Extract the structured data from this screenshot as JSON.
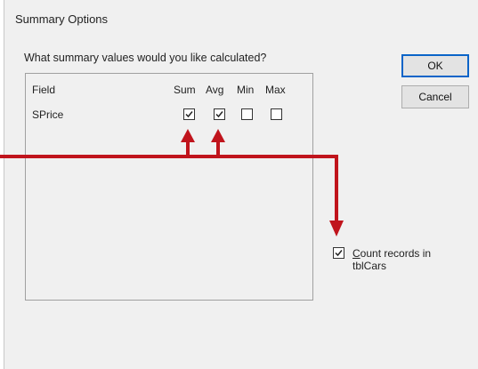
{
  "dialog": {
    "title": "Summary Options",
    "prompt": "What summary values would you like calculated?",
    "ok_label": "OK",
    "cancel_label": "Cancel"
  },
  "grid": {
    "headers": {
      "field": "Field",
      "sum": "Sum",
      "avg": "Avg",
      "min": "Min",
      "max": "Max"
    },
    "rows": [
      {
        "field": "SPrice",
        "sum": true,
        "avg": true,
        "min": false,
        "max": false
      }
    ]
  },
  "count_records": {
    "checked": true,
    "label_access_char": "C",
    "label_rest": "ount records in",
    "label_line2": "tblCars"
  },
  "colors": {
    "annotation": "#c0141c",
    "accent": "#0a64c8"
  }
}
